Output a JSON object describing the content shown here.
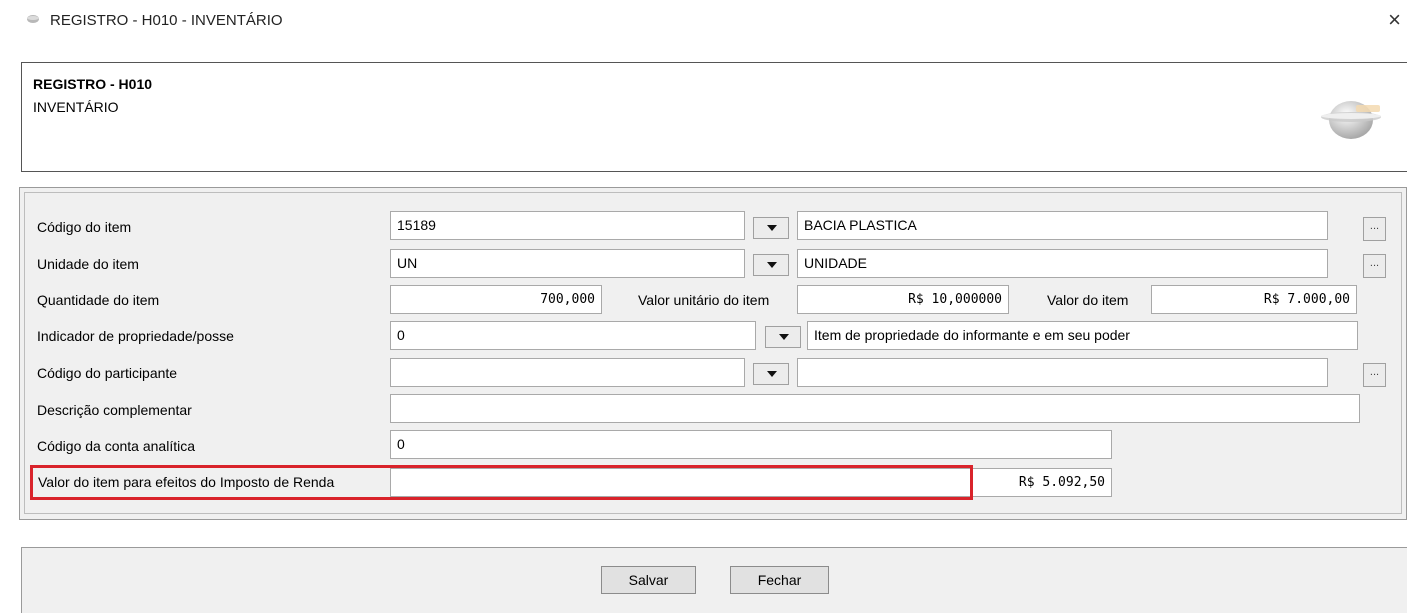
{
  "window": {
    "title": "REGISTRO - H010 - INVENTÁRIO",
    "close_glyph": "×"
  },
  "header": {
    "title": "REGISTRO - H010",
    "subtitle": "INVENTÁRIO",
    "logo_icon": "sped-globe-logo"
  },
  "form": {
    "codigo_item": {
      "label": "Código do item",
      "code": "15189",
      "description": "BACIA PLASTICA"
    },
    "unidade_item": {
      "label": "Unidade do item",
      "code": "UN",
      "description": "UNIDADE"
    },
    "quantidade_item": {
      "label": "Quantidade do item",
      "value": "700,000"
    },
    "valor_unitario": {
      "label": "Valor unitário do item",
      "value": "R$ 10,000000"
    },
    "valor_item": {
      "label": "Valor do item",
      "value": "R$ 7.000,00"
    },
    "indicador_propriedade": {
      "label": "Indicador de propriedade/posse",
      "code": "0",
      "description": "Item de propriedade do informante e em seu poder"
    },
    "codigo_participante": {
      "label": "Código do participante",
      "code": "",
      "description": ""
    },
    "descricao_complementar": {
      "label": "Descrição complementar",
      "value": ""
    },
    "codigo_conta": {
      "label": "Código da conta analítica",
      "value": "0"
    },
    "valor_ir": {
      "label": "Valor do item para efeitos do Imposto de Renda",
      "value": "R$ 5.092,50"
    },
    "ellipsis_label": "...",
    "highlight_color": "#d9232b"
  },
  "footer": {
    "save_label": "Salvar",
    "close_label": "Fechar"
  }
}
